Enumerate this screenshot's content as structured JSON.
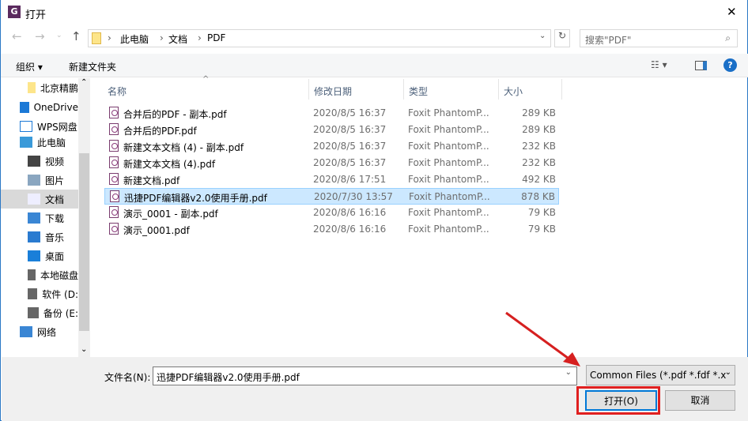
{
  "window": {
    "title": "打开",
    "close": "✕"
  },
  "nav": {
    "breadcrumb": [
      "此电脑",
      "文档",
      "PDF"
    ],
    "search_placeholder": "搜索\"PDF\"",
    "refresh": "↻"
  },
  "toolbar": {
    "organize": "组织 ▾",
    "new_folder": "新建文件夹",
    "help": "?"
  },
  "sidebar": {
    "items": [
      {
        "label": "北京精鹏",
        "icon": "folder-icon"
      },
      {
        "label": "OneDrive",
        "icon": "cloud-icon"
      },
      {
        "label": "WPS网盘",
        "icon": "cloud-outline-icon"
      },
      {
        "label": "此电脑",
        "icon": "computer-icon"
      },
      {
        "label": "视频",
        "icon": "video-icon"
      },
      {
        "label": "图片",
        "icon": "picture-icon"
      },
      {
        "label": "文档",
        "icon": "document-icon",
        "selected": true
      },
      {
        "label": "下载",
        "icon": "download-icon"
      },
      {
        "label": "音乐",
        "icon": "music-icon"
      },
      {
        "label": "桌面",
        "icon": "desktop-icon"
      },
      {
        "label": "本地磁盘",
        "icon": "drive-icon"
      },
      {
        "label": "软件 (D:",
        "icon": "drive-icon"
      },
      {
        "label": "备份 (E:",
        "icon": "drive-icon"
      },
      {
        "label": "网络",
        "icon": "network-icon"
      }
    ]
  },
  "columns": {
    "name": "名称",
    "date": "修改日期",
    "type": "类型",
    "size": "大小"
  },
  "files": [
    {
      "name": "合并后的PDF - 副本.pdf",
      "date": "2020/8/5 16:37",
      "type": "Foxit PhantomP...",
      "size": "289 KB"
    },
    {
      "name": "合并后的PDF.pdf",
      "date": "2020/8/5 16:37",
      "type": "Foxit PhantomP...",
      "size": "289 KB"
    },
    {
      "name": "新建文本文档 (4) - 副本.pdf",
      "date": "2020/8/5 16:37",
      "type": "Foxit PhantomP...",
      "size": "232 KB"
    },
    {
      "name": "新建文本文档 (4).pdf",
      "date": "2020/8/5 16:37",
      "type": "Foxit PhantomP...",
      "size": "232 KB"
    },
    {
      "name": "新建文档.pdf",
      "date": "2020/8/6 17:51",
      "type": "Foxit PhantomP...",
      "size": "492 KB"
    },
    {
      "name": "迅捷PDF编辑器v2.0使用手册.pdf",
      "date": "2020/7/30 13:57",
      "type": "Foxit PhantomP...",
      "size": "878 KB",
      "selected": true
    },
    {
      "name": "演示_0001 - 副本.pdf",
      "date": "2020/8/6 16:16",
      "type": "Foxit PhantomP...",
      "size": "79 KB"
    },
    {
      "name": "演示_0001.pdf",
      "date": "2020/8/6 16:16",
      "type": "Foxit PhantomP...",
      "size": "79 KB"
    }
  ],
  "footer": {
    "filename_label": "文件名(N):",
    "filename_value": "迅捷PDF编辑器v2.0使用手册.pdf",
    "filter": "Common Files (*.pdf *.fdf *.x",
    "open": "打开(O)",
    "cancel": "取消"
  },
  "colors": {
    "accent": "#2b78c5",
    "selected": "#cce8ff",
    "annotation": "#e02020"
  }
}
